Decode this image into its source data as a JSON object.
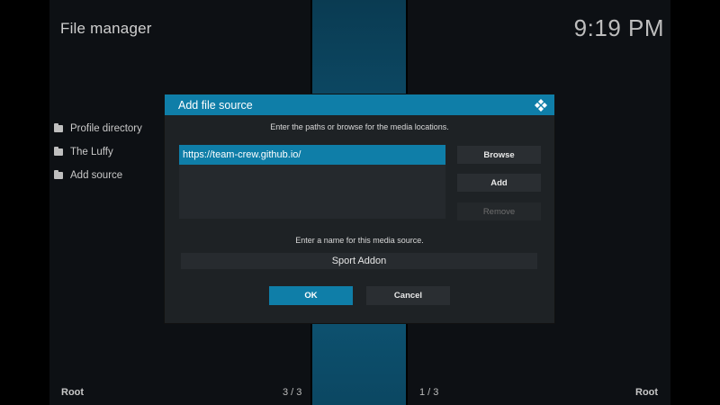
{
  "app": {
    "title": "File manager",
    "clock": "9:19 PM"
  },
  "sources": [
    {
      "label": "Profile directory"
    },
    {
      "label": "The Luffy"
    },
    {
      "label": "Add source"
    }
  ],
  "footer": {
    "left_root": "Root",
    "left_count": "3 / 3",
    "right_count": "1 / 3",
    "right_root": "Root"
  },
  "dialog": {
    "title": "Add file source",
    "paths_hint": "Enter the paths or browse for the media locations.",
    "paths": [
      "https://team-crew.github.io/"
    ],
    "browse_label": "Browse",
    "add_label": "Add",
    "remove_label": "Remove",
    "name_hint": "Enter a name for this media source.",
    "name_value": "Sport Addon",
    "ok_label": "OK",
    "cancel_label": "Cancel"
  },
  "colors": {
    "accent": "#0f7ea8",
    "dialog_bg": "#1e2225"
  },
  "icons": {
    "folder": "folder-icon",
    "kodi": "kodi-logo-icon"
  }
}
